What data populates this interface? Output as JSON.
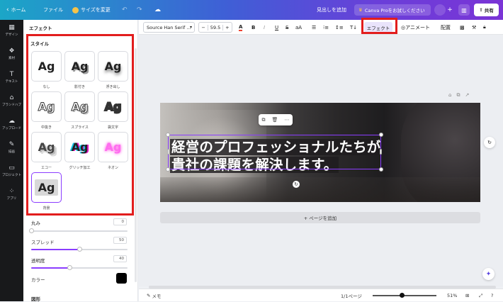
{
  "topbar": {
    "home_label": "ホーム",
    "file_label": "ファイル",
    "resize_label": "サイズを変更",
    "heading_placeholder": "見出しを追加",
    "pro_trial_label": "Canva Proをお試しください",
    "share_label": "共有"
  },
  "leftnav": {
    "items": [
      {
        "label": "デザイン",
        "icon": "layout-icon"
      },
      {
        "label": "素材",
        "icon": "shapes-icon"
      },
      {
        "label": "テキスト",
        "icon": "text-icon"
      },
      {
        "label": "ブランドハブ",
        "icon": "brand-icon"
      },
      {
        "label": "アップロード",
        "icon": "upload-icon"
      },
      {
        "label": "描画",
        "icon": "draw-icon"
      },
      {
        "label": "プロジェクト",
        "icon": "folder-icon"
      },
      {
        "label": "アプリ",
        "icon": "apps-icon"
      }
    ]
  },
  "panel": {
    "title": "エフェクト",
    "styles_heading": "スタイル",
    "sample_text": "Ag",
    "styles": [
      {
        "label": "なし"
      },
      {
        "label": "影付き"
      },
      {
        "label": "浮き出し"
      },
      {
        "label": "中抜き"
      },
      {
        "label": "スプライス"
      },
      {
        "label": "袋文字"
      },
      {
        "label": "エコー"
      },
      {
        "label": "グリッチ加工"
      },
      {
        "label": "ネオン"
      },
      {
        "label": "背景",
        "selected": true
      }
    ],
    "controls": {
      "roundness_label": "丸み",
      "roundness_value": "0",
      "roundness_percent": 0,
      "spread_label": "スプレッド",
      "spread_value": "50",
      "spread_percent": 50,
      "transparency_label": "透明度",
      "transparency_value": "40",
      "transparency_percent": 40,
      "color_label": "カラー",
      "color_value": "#000000",
      "shape_label": "図形"
    }
  },
  "toolbar": {
    "font_name": "Source Han Serif ...",
    "font_size": "59.5",
    "minus": "−",
    "plus": "+",
    "case_label": "aA",
    "effect_label": "エフェクト",
    "animate_label": "アニメート",
    "position_label": "配置"
  },
  "canvas": {
    "heading_line1": "経営のプロフェッショナルたちが",
    "heading_line2": "貴社の課題を解決します。",
    "add_page_label": "+ ページを追加"
  },
  "bottombar": {
    "notes_label": "メモ",
    "page_count": "1/1ページ",
    "zoom": "51%",
    "zoom_fraction": 0.45
  },
  "colors": {
    "accent": "#8b3dff",
    "highlight_red": "#e21d1d"
  }
}
